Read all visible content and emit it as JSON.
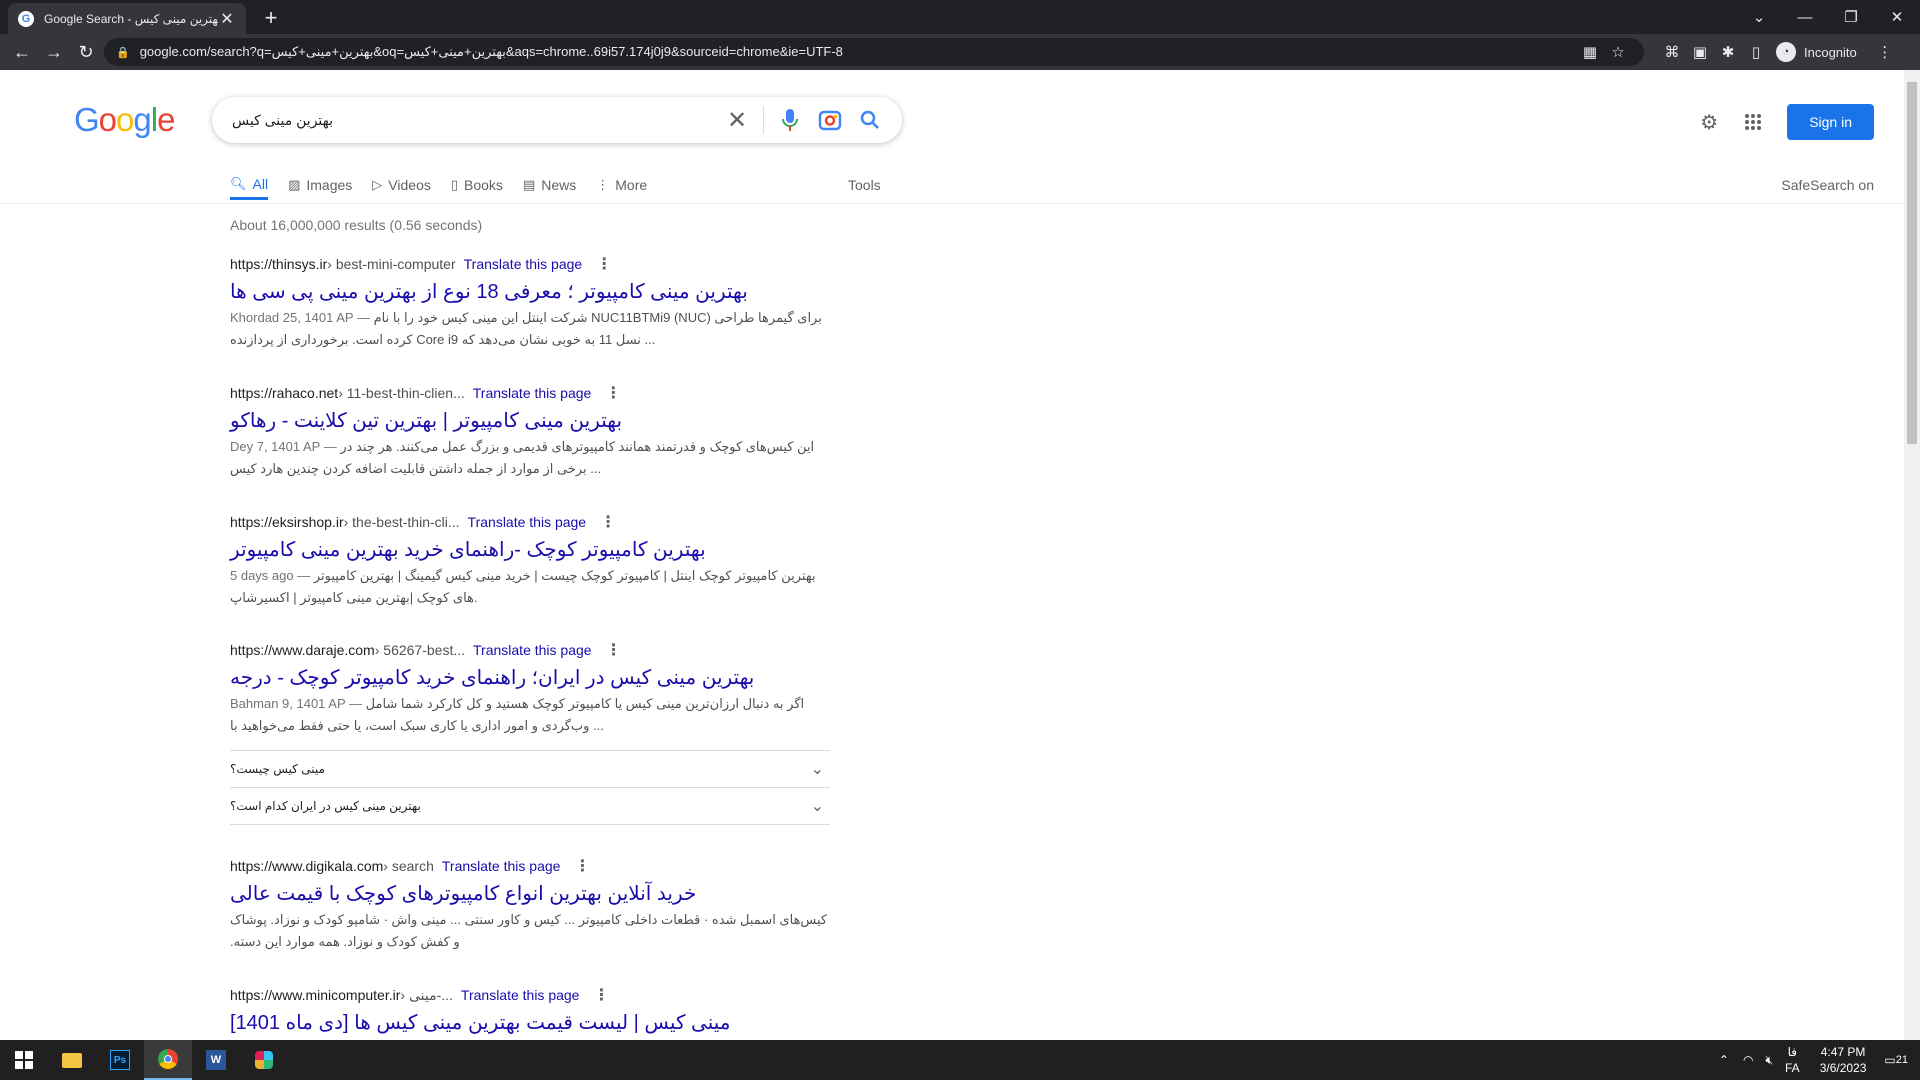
{
  "browser": {
    "tab_title": "Google Search - بهترین مینی کیس",
    "favicon_letter": "G",
    "url": "google.com/search?q=بهترین+مینی+کیس&oq=بهترین+مینی+کیس&aqs=chrome..69i57.174j0j9&sourceid=chrome&ie=UTF-8",
    "profile_label": "Incognito"
  },
  "header": {
    "logo_letters": [
      "G",
      "o",
      "o",
      "g",
      "l",
      "e"
    ],
    "query": "بهترین مینی کیس",
    "signin_label": "Sign in"
  },
  "nav": {
    "tabs": [
      {
        "label": "All",
        "icon": "search-icon"
      },
      {
        "label": "Images",
        "icon": "image-icon"
      },
      {
        "label": "Videos",
        "icon": "video-icon"
      },
      {
        "label": "Books",
        "icon": "book-icon"
      },
      {
        "label": "News",
        "icon": "news-icon"
      },
      {
        "label": "More",
        "icon": "more-vert-icon"
      }
    ],
    "tools_label": "Tools",
    "safesearch_label": "SafeSearch on"
  },
  "stats": "About 16,000,000 results (0.56 seconds)",
  "results": [
    {
      "site": "https://thinsys.ir",
      "path": " › best-mini-computer",
      "translate": "Translate this page",
      "title": "بهترین مینی کامپیوتر ؛ معرفی 18 نوع از بهترین مینی پی سی ها",
      "date": "Khordad 25, 1401 AP — ",
      "snippet": "شرکت اینتل این مینی کیس خود را با نام NUC11BTMi9 (NUC) برای گیمرها طراحی کرده است. برخورداری از پردازنده Core i9 نسل 11 به خوبی نشان می‌دهد که ..."
    },
    {
      "site": "https://rahaco.net",
      "path": " › 11-best-thin-clien...",
      "translate": "Translate this page",
      "title": "بهترین مینی کامپیوتر | بهترین تین کلاینت - رهاکو",
      "date": "Dey 7, 1401 AP — ",
      "snippet": "این کیس‌های کوچک و قدرتمند همانند کامپیوترهای قدیمی و بزرگ عمل می‌کنند. هر چند در برخی از موارد از جمله داشتن قابلیت اضافه کردن چندین هارد کیس ..."
    },
    {
      "site": "https://eksirshop.ir",
      "path": " › the-best-thin-cli...",
      "translate": "Translate this page",
      "title": "بهترین کامپیوتر کوچک -راهنمای خرید بهترین مینی کامپیوتر",
      "date": "5 days ago — ",
      "snippet": "بهترین کامپیوتر کوچک اینتل | کامپیوتر کوچک چیست | خرید مینی کیس گیمینگ | بهترین کامپیوتر های کوچک |بهترین مینی کامپیوتر | اکسیرشاپ."
    },
    {
      "site": "https://www.daraje.com",
      "path": " › 56267-best...",
      "translate": "Translate this page",
      "title": "بهترین مینی کیس در ایران؛ راهنمای خرید کامپیوتر کوچک - درجه",
      "date": "Bahman 9, 1401 AP — ",
      "snippet": "اگر به دنبال ارزان‌ترین مینی کیس یا کامپیوتر کوچک هستید و کل کارکرد شما شامل وب‌گردی و امور اداری یا کاری سبک است، یا حتی فقط می‌خواهید با ..."
    },
    {
      "site": "https://www.digikala.com",
      "path": " › search",
      "translate": "Translate this page",
      "title": "خرید آنلاین بهترین انواع کامپیوترهای کوچک با قیمت عالی",
      "date": "",
      "snippet": "کیس‌های اسمبل شده · قطعات داخلی کامپیوتر ... کیس و کاور سنتی ... مینی واش · شامپو کودک و نوزاد. پوشاک و کفش کودک و نوزاد. همه موارد این دسته."
    },
    {
      "site": "https://www.minicomputer.ir",
      "path": " › مینی-...",
      "translate": "Translate this page",
      "title": "مینی کیس | لیست قیمت بهترین مینی کیس ها [دی ماه 1401]",
      "date": "",
      "snippet": ""
    }
  ],
  "paa": [
    {
      "question": "مینی کیس چیست؟"
    },
    {
      "question": "بهترین مینی کیس در ایران کدام است؟"
    }
  ],
  "taskbar": {
    "lang_top": "فا",
    "lang": "FA",
    "time": "4:47 PM",
    "date": "3/6/2023",
    "notif_count": "21"
  }
}
